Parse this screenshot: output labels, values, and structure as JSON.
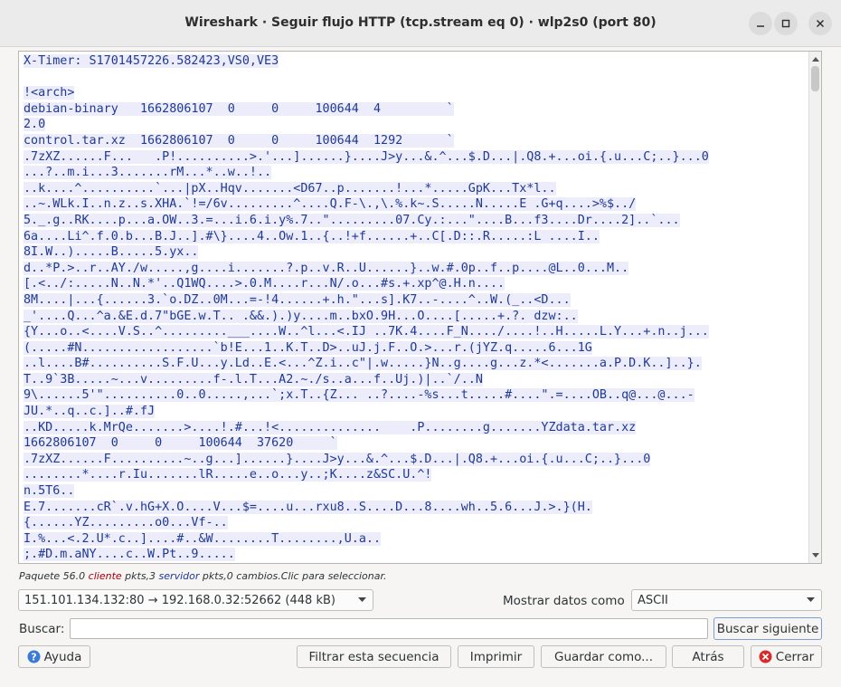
{
  "window": {
    "title": "Wireshark · Seguir flujo HTTP (tcp.stream eq 0) · wlp2s0 (port 80)"
  },
  "stream_lines": [
    {
      "text": "X-Timer: S1701457226.582423,VS0,VE3",
      "style": "inline"
    },
    {
      "text": "",
      "style": "plain"
    },
    {
      "text": "!<arch>",
      "style": "inline"
    },
    {
      "text": "debian-binary   1662806107  0     0     100644  4         `",
      "style": "inline"
    },
    {
      "text": "2.0",
      "style": "inline"
    },
    {
      "text": "control.tar.xz  1662806107  0     0     100644  1292      `",
      "style": "inline"
    },
    {
      "text": ".7zXZ......F...   .P!..........>.'...]......}....J>y...&.^...$.D...|.Q8.+...oi.{.u...C;..}...0",
      "style": "srv"
    },
    {
      "text": "...?..m.i...3.......rM...*..w..!..",
      "style": "inline"
    },
    {
      "text": "..k....^..........`...|pX..Hqv.......<D67..p.......!...*.....GpK...Tx*l..",
      "style": "inline"
    },
    {
      "text": "..~.WLk.I..n.z..s.XHA.`!=/6v.........^....Q.F-\\.,\\.%.k~.S.....N.....E .G+q....>%$../",
      "style": "inline"
    },
    {
      "text": "5._.g..RK....p...a.OW..3.=...i.6.i.y%.7..\".........07.Cy.:...\"....B...f3....Dr....2]..`...",
      "style": "inline"
    },
    {
      "text": "6a....Li^.f.0.b...B.J..].#\\}....4..Ow.1..{..!+f......+..C[.D::.R.....:L ....I..",
      "style": "inline"
    },
    {
      "text": "8I.W..).....B.....5.yx..",
      "style": "inline"
    },
    {
      "text": "d..*P.>..r..AY./w.....,g....i.......?.p..v.R..U......}..w.#.0p..f..p....@L..0...M..",
      "style": "inline"
    },
    {
      "text": "[.<../:.....N..N.*'..Q1WQ....>.0.M....r...N/.o...#s.+.xp^@.H.n....",
      "style": "inline"
    },
    {
      "text": "8M....|...{......3.`o.DZ..0M...=-!4......+.h.\"...s].K7..-....^..W.(_..<D...",
      "style": "inline"
    },
    {
      "text": "_'....Q...^a.&E.d.7\"bGE.w.T.. .&&.).)y....m..bxO.9H...O....[.....+.?. dzw:..",
      "style": "inline"
    },
    {
      "text": "{Y...o..<....V.S..^.........___....W..^l...<.IJ ..7K.4....F_N..../....!..H.....L.Y...+.n..j...",
      "style": "inline"
    },
    {
      "text": "(.....#N..................`b!E...1..K.T..D>..uJ.j.F..O.>...r.(jYZ.q.....6...1G",
      "style": "inline"
    },
    {
      "text": "..l....B#..........S.F.U...y.Ld..E.<...^Z.i..c\"|.w.....}N..g....g...z.*<.......a.P.D.K..]..}.",
      "style": "inline"
    },
    {
      "text": "T..9`3B.....~...v.........f-.l.T...A2.~./s..a...f..Uj.)|..`/..N",
      "style": "inline"
    },
    {
      "text": "9\\......5'\"..........0..0.....,...`;x.T..{Z... ..?....-%s...t.....#....\".=....OB..q@...@...-",
      "style": "inline"
    },
    {
      "text": "JU.*..q..c.]..#.fJ",
      "style": "inline"
    },
    {
      "text": "..KD.....k.MrQe.......>....!.#...!<..............    .P........g.......YZdata.tar.xz",
      "style": "inline"
    },
    {
      "text": "1662806107  0     0     100644  37620     `",
      "style": "inline"
    },
    {
      "text": ".7zXZ......F..........~..g...]......}....J>y...&.^...$.D...|.Q8.+...oi.{.u...C;..}...0",
      "style": "inline"
    },
    {
      "text": "........*....r.Iu.......lR.....e..o...y..;K....z&SC.U.^!",
      "style": "inline"
    },
    {
      "text": "n.5T6..",
      "style": "inline"
    },
    {
      "text": "E.7.......cR`.v.hG+X.O....V...$=....u...rxu8..S....D...8....wh..5.6...J.>.}(H.",
      "style": "inline"
    },
    {
      "text": "{......YZ.........o0...Vf-..",
      "style": "inline"
    },
    {
      "text": "I.%...<.2.U*.c..]....#..&W........T........,U.a..",
      "style": "inline"
    },
    {
      "text": ";.#D.m.aNY....c..W.Pt..9.....",
      "style": "inline"
    }
  ],
  "status": {
    "prefix": "Paquete 56.0 ",
    "client_word": "cliente",
    "middle": " pkts,3 ",
    "server_word": "servidor",
    "suffix": " pkts,0 cambios.Clic para seleccionar."
  },
  "conversation": {
    "selected": "151.101.134.132:80 → 192.168.0.32:52662 (448 kB)"
  },
  "show_data_as": {
    "label": "Mostrar datos como",
    "selected": "ASCII"
  },
  "find": {
    "label": "Buscar:",
    "value": "",
    "next_label": "Buscar siguiente"
  },
  "buttons": {
    "help": "Ayuda",
    "filter": "Filtrar esta secuencia",
    "print": "Imprimir",
    "save": "Guardar como...",
    "back": "Atrás",
    "close": "Cerrar"
  },
  "colors": {
    "server_text": "#1f3a93",
    "server_bg": "#ececfb",
    "client_text": "#a4000f"
  }
}
